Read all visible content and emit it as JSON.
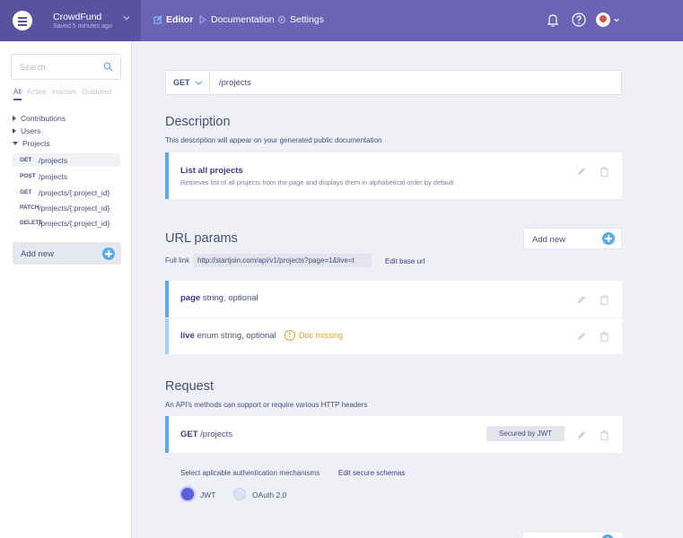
{
  "app": {
    "name": "CrowdFund",
    "saved": "Saved 5 minutes ago"
  },
  "nav": {
    "editor": "Editor",
    "documentation": "Documentation",
    "settings": "Settings"
  },
  "sidebar": {
    "search_placeholder": "Search",
    "filters": [
      "All",
      "Active",
      "Inactive",
      "Outdated"
    ],
    "tree": [
      "Contributions",
      "Users",
      "Projects"
    ],
    "endpoints": [
      {
        "method": "GET",
        "path": "/projects"
      },
      {
        "method": "POST",
        "path": "/projects"
      },
      {
        "method": "GET",
        "path": "/projects/{:project_id}"
      },
      {
        "method": "PATCH",
        "path": "/projects/{:project_id}"
      },
      {
        "method": "DELETE",
        "path": "/projects/{:project_id}"
      }
    ],
    "add_new": "Add new"
  },
  "url_bar": {
    "method": "GET",
    "path": "/projects"
  },
  "description": {
    "heading": "Description",
    "subtitle": "This description will appear on your generated public documentation",
    "title": "List all projects",
    "text": "Retrieves list of all projects from the page and displays them in alphabetical order by default"
  },
  "url_params": {
    "heading": "URL params",
    "add_new": "Add new",
    "full_link_label": "Full link",
    "full_link": "http://startjoin.com/api/v1/projects?page=1&live=t",
    "edit_base_url": "Edit base url",
    "params": [
      {
        "name": "page",
        "type": "string, optional"
      },
      {
        "name": "live",
        "type": "enum string, optional",
        "warning": "Doc missing"
      }
    ]
  },
  "request": {
    "heading": "Request",
    "subtitle": "An API's methods can support or require various HTTP headers",
    "method": "GET",
    "path": "/projects",
    "secured": "Secured by JWT",
    "auth_label": "Select aplicable authentication mechanisms",
    "edit_schemas": "Edit secure schemas",
    "options": [
      "JWT",
      "OAuth 2.0"
    ]
  },
  "colors": {
    "topbar": "#6b63b5",
    "accent": "#5aa9ea",
    "warning": "#e3a21a"
  }
}
